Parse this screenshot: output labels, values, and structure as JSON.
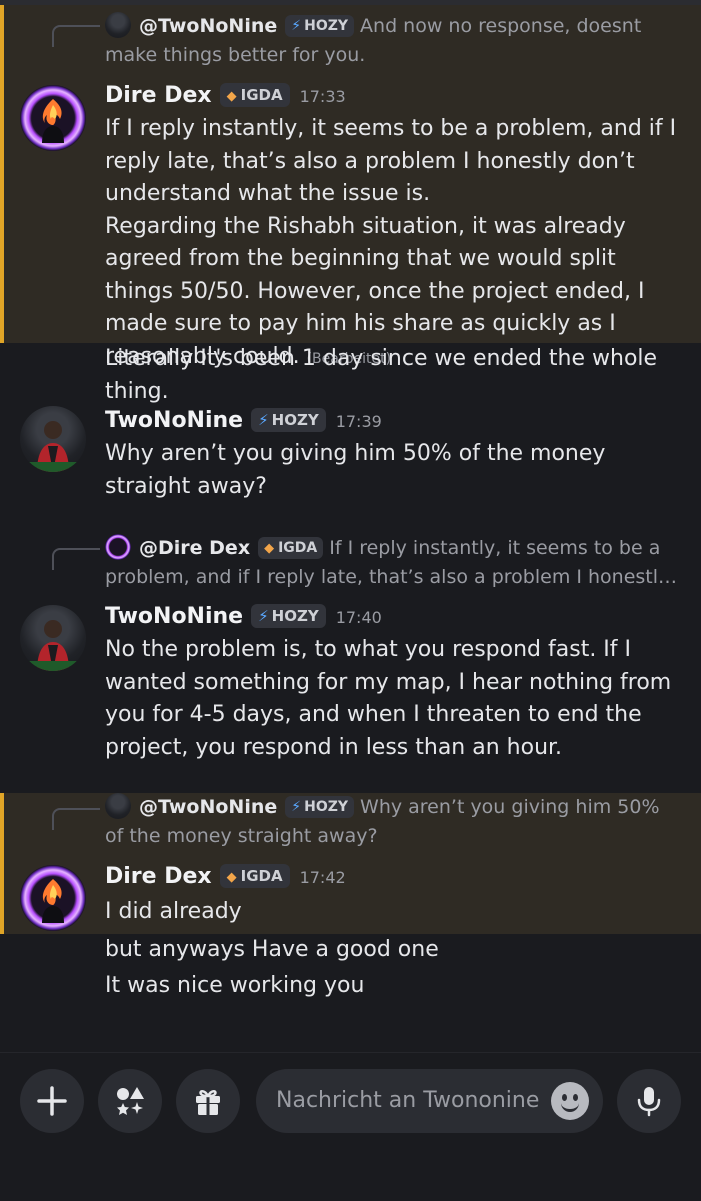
{
  "messages": {
    "m1": {
      "reply": {
        "name": "@TwoNoNine",
        "tag": "HOZY",
        "text": "And now no response, doesnt make things better for you."
      },
      "author": "Dire Dex",
      "tag": "IGDA",
      "time": "17:33",
      "lines": [
        "If I reply instantly, it seems to be a problem, and if I reply late, that’s also a problem I honestly don’t understand what the issue is.",
        "Regarding the Rishabh situation, it was already agreed from the beginning that we would split things 50/50. However, once the project ended, I made sure to pay him his share as quickly as I reasonably could."
      ],
      "edited": "(Bearbeitet)",
      "followup": "Literally It's been 1 day since we ended the whole thing."
    },
    "m2": {
      "author": "TwoNoNine",
      "tag": "HOZY",
      "time": "17:39",
      "text": "Why aren’t you giving him 50% of the money straight away?"
    },
    "m3": {
      "reply": {
        "name": "@Dire Dex",
        "tag": "IGDA",
        "text": "If I reply instantly, it seems to be a problem, and if I reply late, that’s also a problem I honestl…"
      },
      "author": "TwoNoNine",
      "tag": "HOZY",
      "time": "17:40",
      "text": "No the problem is, to what you respond fast. If I wanted something for my map, I hear nothing from you for 4-5 days, and when I threaten to end the project, you respond in less than an hour."
    },
    "m4": {
      "reply": {
        "name": "@TwoNoNine",
        "tag": "HOZY",
        "text": "Why aren’t you giving him 50% of the money straight away?"
      },
      "author": "Dire Dex",
      "tag": "IGDA",
      "time": "17:42",
      "text": "I did already",
      "followup1": "but anyways Have a good one",
      "followup2": "It was nice working you"
    }
  },
  "composer": {
    "placeholder": "Nachricht an Twononine",
    "icons": [
      "plus-icon",
      "apps-icon",
      "gift-icon",
      "emoji-icon",
      "microphone-icon"
    ]
  },
  "colors": {
    "mention_bar": "#e0a527",
    "mention_bg": "#2f2b24",
    "background": "#1a1b1f",
    "bolt": "#5aa8ff"
  }
}
